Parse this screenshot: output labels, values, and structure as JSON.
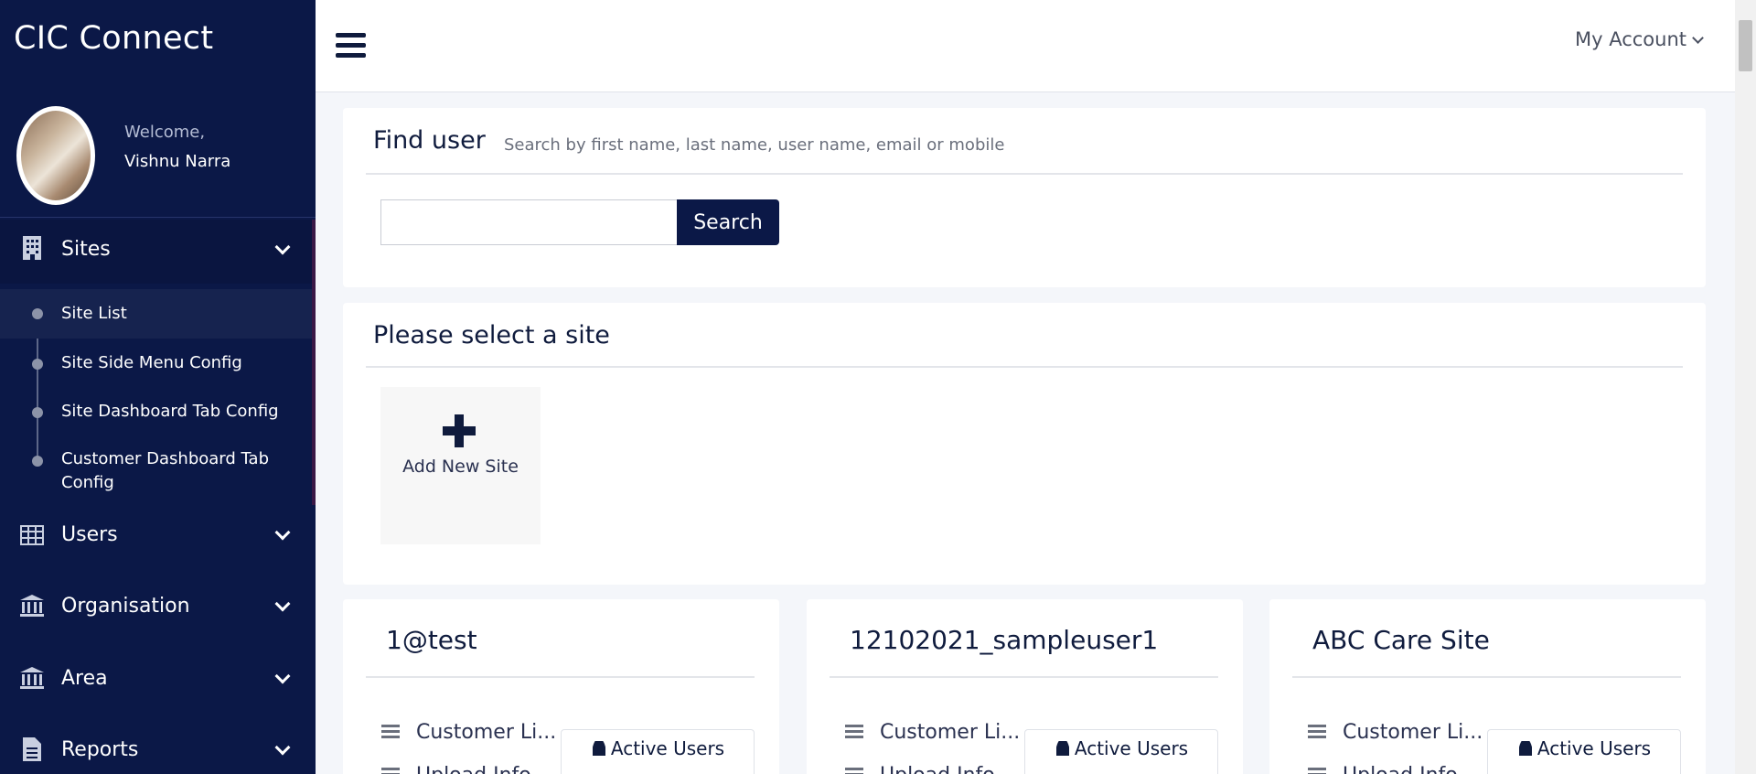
{
  "app": {
    "title": "CIC Connect"
  },
  "profile": {
    "welcome": "Welcome,",
    "name": "Vishnu Narra"
  },
  "sidebar": {
    "sections": [
      {
        "label": "Sites",
        "icon": "building-icon"
      },
      {
        "label": "Users",
        "icon": "table-icon"
      },
      {
        "label": "Organisation",
        "icon": "bank-icon"
      },
      {
        "label": "Area",
        "icon": "bank-icon"
      },
      {
        "label": "Reports",
        "icon": "document-icon"
      }
    ],
    "sites_submenu": [
      {
        "label": "Site List",
        "active": true
      },
      {
        "label": "Site Side Menu Config"
      },
      {
        "label": "Site Dashboard Tab Config"
      },
      {
        "label": "Customer Dashboard Tab Config"
      }
    ]
  },
  "topbar": {
    "account_label": "My Account"
  },
  "find_user": {
    "title": "Find user",
    "hint": "Search by first name, last name, user name, email or mobile",
    "input_value": "",
    "search_label": "Search"
  },
  "select_site": {
    "title": "Please select a site",
    "add_label": "Add New Site"
  },
  "sites": [
    {
      "name": "1@test",
      "row1": "Customer Li...",
      "row2": "Upload Info...",
      "active_users_label": "Active Users"
    },
    {
      "name": "12102021_sampleuser1",
      "row1": "Customer Li...",
      "row2": "Upload Info...",
      "active_users_label": "Active Users"
    },
    {
      "name": "ABC Care Site",
      "row1": "Customer Li...",
      "row2": "Upload Info...",
      "active_users_label": "Active Users"
    }
  ],
  "colors": {
    "sidebar_bg": "#0b1847",
    "accent": "#0b1847",
    "page_bg": "#f4f6fa"
  }
}
